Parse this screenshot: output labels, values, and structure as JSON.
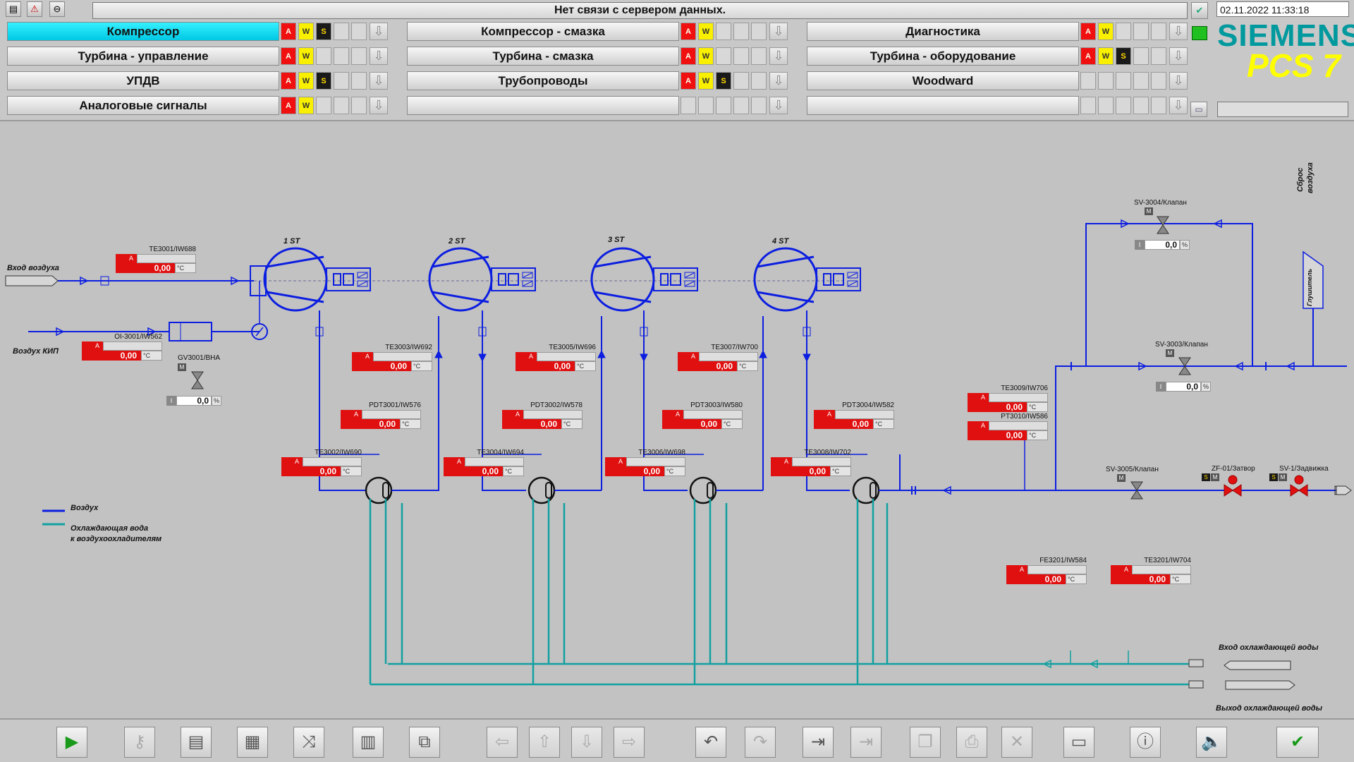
{
  "header": {
    "server_status": "Нет связи с сервером данных.",
    "datetime": "02.11.2022 11:33:18",
    "logo_top": "SIEMENS",
    "logo_bottom": "PCS 7",
    "areas": [
      {
        "label": "Компрессор",
        "active": true,
        "a": true,
        "w": true,
        "s": true
      },
      {
        "label": "Компрессор - смазка",
        "active": false,
        "a": true,
        "w": true,
        "s": false
      },
      {
        "label": "Диагностика",
        "active": false,
        "a": true,
        "w": true,
        "s": false
      },
      {
        "label": "Турбина - управление",
        "active": false,
        "a": true,
        "w": true,
        "s": false
      },
      {
        "label": "Турбина - смазка",
        "active": false,
        "a": true,
        "w": true,
        "s": false
      },
      {
        "label": "Турбина - оборудование",
        "active": false,
        "a": true,
        "w": true,
        "s": true
      },
      {
        "label": "УПДВ",
        "active": false,
        "a": true,
        "w": true,
        "s": true
      },
      {
        "label": "Трубопроводы",
        "active": false,
        "a": true,
        "w": true,
        "s": true
      },
      {
        "label": "Woodward",
        "active": false,
        "a": false,
        "w": false,
        "s": false
      },
      {
        "label": "Аналоговые сигналы",
        "active": false,
        "a": true,
        "w": true,
        "s": false
      },
      {
        "label": "",
        "active": false,
        "a": false,
        "w": false,
        "s": false
      },
      {
        "label": "",
        "active": false,
        "a": false,
        "w": false,
        "s": false
      }
    ],
    "cell_labels": {
      "a": "A",
      "w": "W",
      "s": "S"
    }
  },
  "process": {
    "labels": {
      "air_in": "Вход воздуха",
      "air_kip": "Воздух КИП",
      "legend_air": "Воздух",
      "legend_water_1": "Охлаждающая вода",
      "legend_water_2": "к воздухоохладителям",
      "cooling_in": "Вход охлаждающей воды",
      "cooling_out": "Выход охлаждающей воды",
      "air_discharge_1": "Сброс",
      "air_discharge_2": "воздуха",
      "silencer": "Глушитель"
    },
    "stages": [
      "1 ST",
      "2 ST",
      "3 ST",
      "4 ST"
    ],
    "colors": {
      "air": "#0c1ee0",
      "water": "#12a0a0",
      "alarm": "#e01010"
    },
    "faceplates": [
      {
        "tag": "TE3001/IW688",
        "value": "0,00",
        "unit": "°C"
      },
      {
        "tag": "OI-3001/IW562",
        "value": "0,00",
        "unit": "°C"
      },
      {
        "tag": "TE3003/IW692",
        "value": "0,00",
        "unit": "°C"
      },
      {
        "tag": "TE3005/IW696",
        "value": "0,00",
        "unit": "°C"
      },
      {
        "tag": "TE3007/IW700",
        "value": "0,00",
        "unit": "°C"
      },
      {
        "tag": "PDT3001/IW576",
        "value": "0,00",
        "unit": "°C"
      },
      {
        "tag": "PDT3002/IW578",
        "value": "0,00",
        "unit": "°C"
      },
      {
        "tag": "PDT3003/IW580",
        "value": "0,00",
        "unit": "°C"
      },
      {
        "tag": "PDT3004/IW582",
        "value": "0,00",
        "unit": "°C"
      },
      {
        "tag": "TE3002/IW690",
        "value": "0,00",
        "unit": "°C"
      },
      {
        "tag": "TE3004/IW694",
        "value": "0,00",
        "unit": "°C"
      },
      {
        "tag": "TE3006/IW698",
        "value": "0,00",
        "unit": "°C"
      },
      {
        "tag": "TE3008/IW702",
        "value": "0,00",
        "unit": "°C"
      },
      {
        "tag": "TE3009/IW706",
        "value": "0,00",
        "unit": "°C"
      },
      {
        "tag": "PT3010/IW586",
        "value": "0,00",
        "unit": "°C"
      },
      {
        "tag": "FE3201/IW584",
        "value": "0,00",
        "unit": "°C"
      },
      {
        "tag": "TE3201/IW704",
        "value": "0,00",
        "unit": "°C"
      }
    ],
    "valves": {
      "gv3001": {
        "tag": "GV3001/BHA",
        "mode": "M",
        "value": "0,0",
        "unit": "%"
      },
      "sv3004": {
        "tag": "SV-3004/Клапан",
        "mode": "M",
        "value": "0,0",
        "unit": "%"
      },
      "sv3003": {
        "tag": "SV-3003/Клапан",
        "mode": "M",
        "value": "0,0",
        "unit": "%"
      },
      "sv3005": {
        "tag": "SV-3005/Клапан",
        "mode": "M"
      },
      "zf01": {
        "tag": "ZF-01/Затвор",
        "mode": "M",
        "sim": "S"
      },
      "sv1": {
        "tag": "SV-1/Задвижка",
        "mode": "M",
        "sim": "S"
      }
    },
    "alarm_letter": "A",
    "interlock_letter": "I"
  },
  "toolbar": {
    "buttons": [
      {
        "name": "start-runtime-button",
        "glyph": "▶"
      },
      {
        "name": "key-button",
        "glyph": "⚷"
      },
      {
        "name": "alarm-list-button",
        "glyph": "▤"
      },
      {
        "name": "report-button",
        "glyph": "▦"
      },
      {
        "name": "trend-button",
        "glyph": "⤨"
      },
      {
        "name": "thermometer-button",
        "glyph": "▥"
      },
      {
        "name": "picture-select-button",
        "glyph": "⧉"
      },
      {
        "name": "nav-left-button",
        "glyph": "⇦"
      },
      {
        "name": "nav-up-button",
        "glyph": "⇧"
      },
      {
        "name": "nav-down-button",
        "glyph": "⇩"
      },
      {
        "name": "nav-right-button",
        "glyph": "⇨"
      },
      {
        "name": "back-button",
        "glyph": "↶"
      },
      {
        "name": "forward-button",
        "glyph": "↷"
      },
      {
        "name": "store-picture-button",
        "glyph": "⇥"
      },
      {
        "name": "recall-picture-button",
        "glyph": "⇥"
      },
      {
        "name": "window-stack-button",
        "glyph": "❐"
      },
      {
        "name": "window-print-button",
        "glyph": "⎙"
      },
      {
        "name": "window-close-button",
        "glyph": "✕"
      },
      {
        "name": "monitor-button",
        "glyph": "▭"
      },
      {
        "name": "info-button",
        "glyph": "ⓘ"
      },
      {
        "name": "horn-ack-button",
        "glyph": "🔈"
      },
      {
        "name": "ack-all-button",
        "glyph": "✔"
      }
    ]
  }
}
